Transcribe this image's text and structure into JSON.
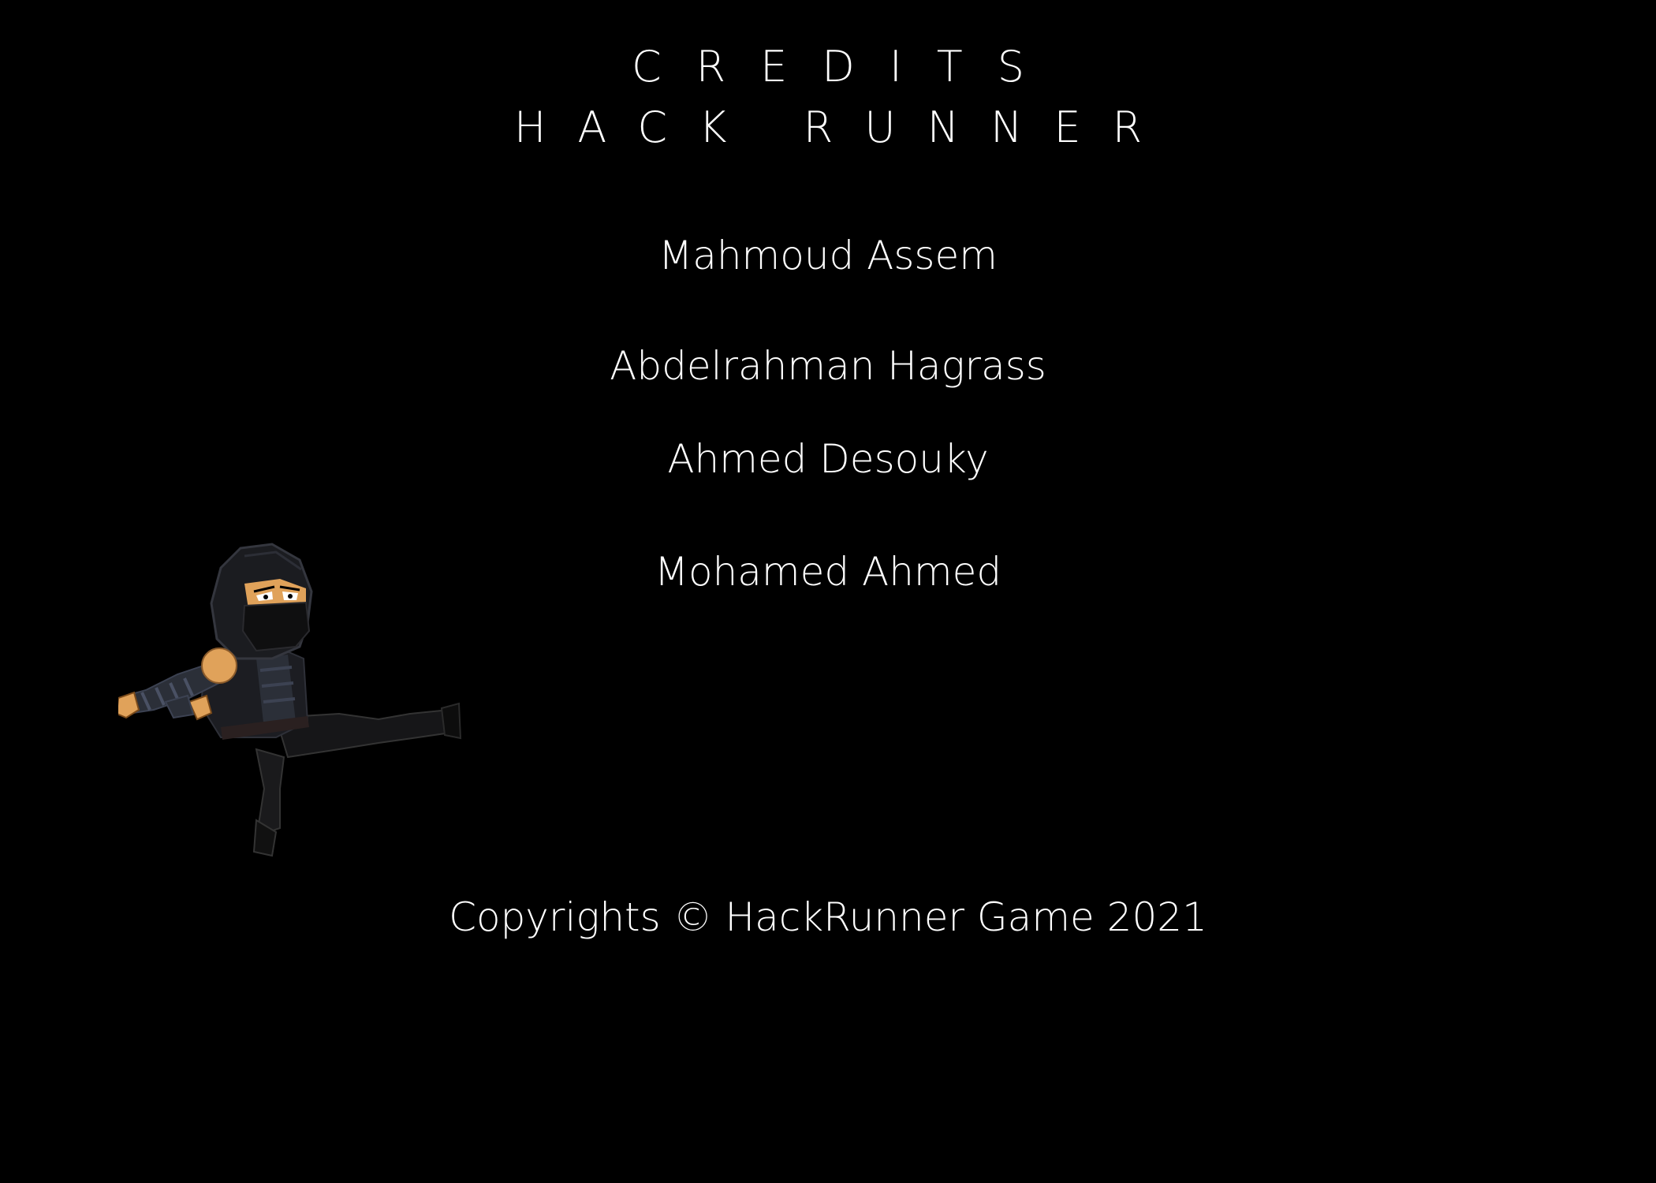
{
  "header": {
    "title": "CREDITS",
    "game_title": "HACK RUNNER"
  },
  "credits": {
    "names": [
      "Mahmoud Assem",
      "Abdelrahman Hagrass",
      "Ahmed Desouky",
      "Mohamed Ahmed"
    ]
  },
  "footer": {
    "copyright": "Copyrights © HackRunner Game 2021"
  },
  "sprite": {
    "icon": "ninja-character-icon"
  },
  "colors": {
    "background": "#000000",
    "text": "#ffffff",
    "skin": "#e0a25a",
    "cloth_dark": "#141414",
    "cloth_mid": "#2b2f38",
    "wrap": "#3c4252"
  }
}
